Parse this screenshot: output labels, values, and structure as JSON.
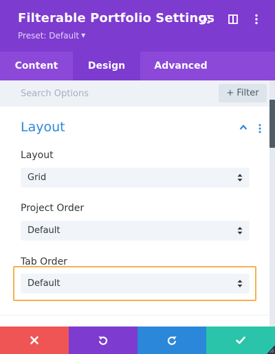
{
  "header": {
    "title": "Filterable Portfolio Settings",
    "preset_label": "Preset: Default",
    "background": "#7e3bd0",
    "icons": [
      "expand-icon",
      "sidebar-layout-icon",
      "more-vertical-icon"
    ]
  },
  "tabs": [
    {
      "label": "Content",
      "active": false
    },
    {
      "label": "Design",
      "active": true
    },
    {
      "label": "Advanced",
      "active": false
    }
  ],
  "search": {
    "placeholder": "Search Options",
    "filter_label": "+ Filter"
  },
  "section": {
    "title": "Layout",
    "accent": "#2b87da",
    "fields": [
      {
        "label": "Layout",
        "value": "Grid"
      },
      {
        "label": "Project Order",
        "value": "Default"
      },
      {
        "label": "Tab Order",
        "value": "Default",
        "highlighted": true
      }
    ]
  },
  "highlight_color": "#f3b14e",
  "footer": {
    "buttons": [
      {
        "icon": "close-icon",
        "color": "#ef5555"
      },
      {
        "icon": "undo-icon",
        "color": "#7e3bd0"
      },
      {
        "icon": "redo-icon",
        "color": "#2b87da"
      },
      {
        "icon": "checkmark-icon",
        "color": "#29c4a9"
      }
    ]
  }
}
